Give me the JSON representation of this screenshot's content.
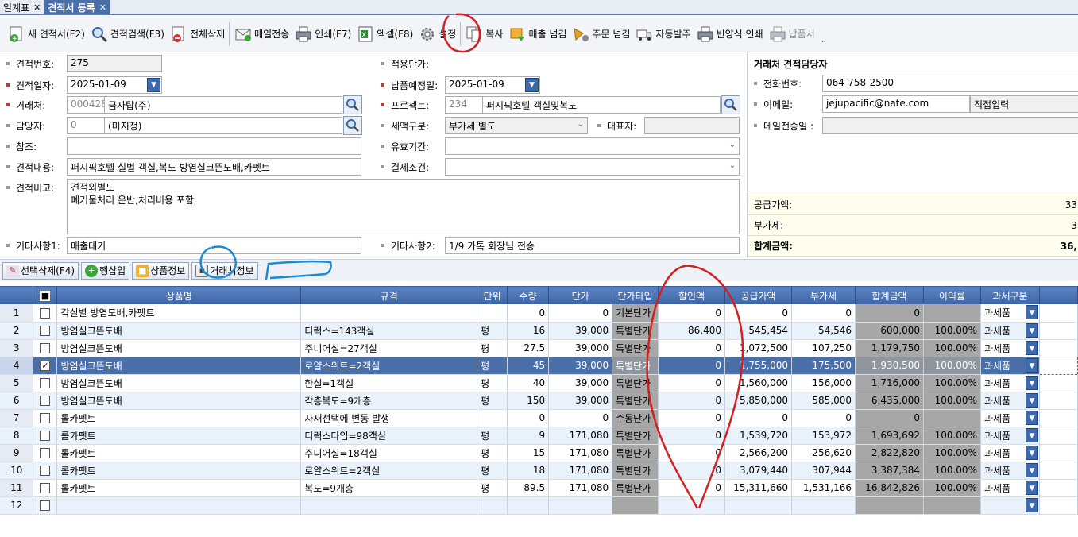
{
  "tabs": [
    {
      "label": "일계표",
      "active": false
    },
    {
      "label": "견적서 등록",
      "active": true
    }
  ],
  "toolbar": {
    "new_quote": "새 견적서(F2)",
    "search_quote": "견적검색(F3)",
    "delete_all": "전체삭제",
    "send_mail": "메일전송",
    "print": "인쇄(F7)",
    "excel": "엑셀(F8)",
    "settings": "설정",
    "copy": "복사",
    "to_sales": "매출 넘김",
    "to_order": "주문 넘김",
    "auto_order": "자동발주",
    "blank_print": "빈양식 인쇄",
    "delivery_note": "납품서"
  },
  "form": {
    "quote_no_label": "견적번호:",
    "quote_no": "275",
    "quote_date_label": "견적일자:",
    "quote_date": "2025-01-09",
    "client_label": "거래처:",
    "client_code": "000428",
    "client_name": "금자탑(주)",
    "manager_label": "담당자:",
    "manager_code": "0",
    "manager_name": "(미지정)",
    "reference_label": "참조:",
    "reference": "",
    "content_label": "견적내용:",
    "content": "퍼시픽호텔 실별 객실,복도 방염실크뜬도배,카펫트",
    "remark_label": "견적비고:",
    "remark_line1": "견적외별도",
    "remark_line2": "폐기물처리 운반,처리비용 포함",
    "etc1_label": "기타사항1:",
    "etc1": "매출대기",
    "price_apply_label": "적용단가:",
    "delivery_date_label": "납품예정일:",
    "delivery_date": "2025-01-09",
    "project_label": "프로젝트:",
    "project_code": "234",
    "project_name": "퍼시픽호텔 객실및복도",
    "tax_label": "세액구분:",
    "tax_value": "부가세 별도",
    "rep_label": "대표자:",
    "valid_label": "유효기간:",
    "payment_label": "결제조건:",
    "etc2_label": "기타사항2:",
    "etc2": "1/9 카톡 회장님 전송"
  },
  "right": {
    "title": "거래처 견적담당자",
    "phone_label": "전화번호:",
    "phone": "064-758-2500",
    "email_label": "이메일:",
    "email": "jejupacific@nate.com",
    "direct_input": "직접입력",
    "mail_sent_label": "메일전송일 :",
    "supply_label": "공급가액:",
    "supply_value": "33",
    "vat_label": "부가세:",
    "vat_value": "3",
    "total_label": "합계금액:",
    "total_value": "36,"
  },
  "gridbar": {
    "delete_sel": "선택삭제(F4)",
    "insert_row": "행삽입",
    "product_info": "상품정보",
    "client_info": "거래처정보"
  },
  "grid": {
    "headers": [
      "",
      "상품명",
      "규격",
      "단위",
      "수량",
      "단가",
      "단가타입",
      "할인액",
      "공급가액",
      "부가세",
      "합계금액",
      "이익률",
      "과세구분"
    ],
    "rows": [
      {
        "no": "1",
        "checked": false,
        "name": "각실별 방염도배,카펫트",
        "spec": "",
        "unit": "",
        "qty": "0",
        "price": "0",
        "ptype": "기본단가",
        "discount": "0",
        "supply": "0",
        "vat": "0",
        "total": "0",
        "margin": "",
        "tax": "과세품"
      },
      {
        "no": "2",
        "checked": false,
        "name": "방염실크뜬도배",
        "spec": "디럭스=143객실",
        "unit": "평",
        "qty": "16",
        "price": "39,000",
        "ptype": "특별단가",
        "discount": "86,400",
        "supply": "545,454",
        "vat": "54,546",
        "total": "600,000",
        "margin": "100.00%",
        "tax": "과세품"
      },
      {
        "no": "3",
        "checked": false,
        "name": "방염실크뜬도배",
        "spec": "주니어실=27객실",
        "unit": "평",
        "qty": "27.5",
        "price": "39,000",
        "ptype": "특별단가",
        "discount": "0",
        "supply": "1,072,500",
        "vat": "107,250",
        "total": "1,179,750",
        "margin": "100.00%",
        "tax": "과세품"
      },
      {
        "no": "4",
        "checked": true,
        "name": "방염실크뜬도배",
        "spec": "로얄스위트=2객실",
        "unit": "평",
        "qty": "45",
        "price": "39,000",
        "ptype": "특별단가",
        "discount": "0",
        "supply": "1,755,000",
        "vat": "175,500",
        "total": "1,930,500",
        "margin": "100.00%",
        "tax": "과세품"
      },
      {
        "no": "5",
        "checked": false,
        "name": "방염실크뜬도배",
        "spec": "한실=1객실",
        "unit": "평",
        "qty": "40",
        "price": "39,000",
        "ptype": "특별단가",
        "discount": "0",
        "supply": "1,560,000",
        "vat": "156,000",
        "total": "1,716,000",
        "margin": "100.00%",
        "tax": "과세품"
      },
      {
        "no": "6",
        "checked": false,
        "name": "방염실크뜬도배",
        "spec": "각층복도=9개층",
        "unit": "평",
        "qty": "150",
        "price": "39,000",
        "ptype": "특별단가",
        "discount": "0",
        "supply": "5,850,000",
        "vat": "585,000",
        "total": "6,435,000",
        "margin": "100.00%",
        "tax": "과세품"
      },
      {
        "no": "7",
        "checked": false,
        "name": "롤카펫트",
        "spec": "자재선택에 변동 발생",
        "unit": "",
        "qty": "0",
        "price": "0",
        "ptype": "수동단가",
        "discount": "0",
        "supply": "0",
        "vat": "0",
        "total": "0",
        "margin": "",
        "tax": "과세품"
      },
      {
        "no": "8",
        "checked": false,
        "name": "롤카펫트",
        "spec": "디럭스타입=98객실",
        "unit": "평",
        "qty": "9",
        "price": "171,080",
        "ptype": "특별단가",
        "discount": "0",
        "supply": "1,539,720",
        "vat": "153,972",
        "total": "1,693,692",
        "margin": "100.00%",
        "tax": "과세품"
      },
      {
        "no": "9",
        "checked": false,
        "name": "롤카펫트",
        "spec": "주니어실=18객실",
        "unit": "평",
        "qty": "15",
        "price": "171,080",
        "ptype": "특별단가",
        "discount": "0",
        "supply": "2,566,200",
        "vat": "256,620",
        "total": "2,822,820",
        "margin": "100.00%",
        "tax": "과세품"
      },
      {
        "no": "10",
        "checked": false,
        "name": "롤카펫트",
        "spec": "로얄스위트=2객실",
        "unit": "평",
        "qty": "18",
        "price": "171,080",
        "ptype": "특별단가",
        "discount": "0",
        "supply": "3,079,440",
        "vat": "307,944",
        "total": "3,387,384",
        "margin": "100.00%",
        "tax": "과세품"
      },
      {
        "no": "11",
        "checked": false,
        "name": "롤카펫트",
        "spec": "복도=9개층",
        "unit": "평",
        "qty": "89.5",
        "price": "171,080",
        "ptype": "특별단가",
        "discount": "0",
        "supply": "15,311,660",
        "vat": "1,531,166",
        "total": "16,842,826",
        "margin": "100.00%",
        "tax": "과세품"
      },
      {
        "no": "12",
        "checked": false,
        "name": "",
        "spec": "",
        "unit": "",
        "qty": "",
        "price": "",
        "ptype": "",
        "discount": "",
        "supply": "",
        "vat": "",
        "total": "",
        "margin": "",
        "tax": ""
      }
    ]
  },
  "colors": {
    "header_blue": "#3f66a6",
    "selected_row": "#4a6fa8",
    "annotation_red": "#d42020",
    "annotation_blue": "#1a8ad4"
  }
}
